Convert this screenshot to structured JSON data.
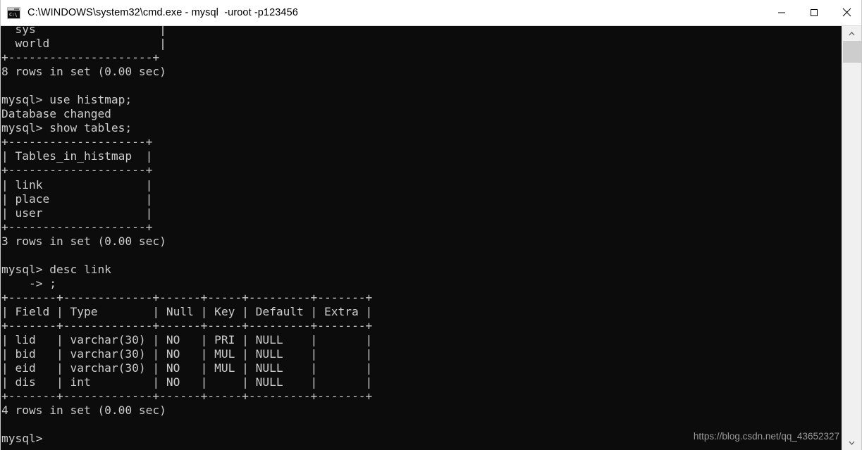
{
  "window": {
    "title": "C:\\WINDOWS\\system32\\cmd.exe - mysql  -uroot -p123456",
    "icon_name": "cmd-exe-icon",
    "icon_prompt_glyph": "C:\\",
    "background_color": "#0c0c0c",
    "titlebar_background": "#ffffff",
    "text_color": "#cccccc"
  },
  "controls": {
    "minimize_label": "Minimize",
    "maximize_label": "Maximize",
    "close_label": "Close"
  },
  "console": {
    "prompt": "mysql>",
    "continuation_prompt": "    -> ",
    "text": "  sys                  |\n  world                |\n+---------------------+\n8 rows in set (0.00 sec)\n\nmysql> use histmap;\nDatabase changed\nmysql> show tables;\n+--------------------+\n| Tables_in_histmap  |\n+--------------------+\n| link               |\n| place              |\n| user               |\n+--------------------+\n3 rows in set (0.00 sec)\n\nmysql> desc link\n    -> ;\n+-------+-------------+------+-----+---------+-------+\n| Field | Type        | Null | Key | Default | Extra |\n+-------+-------------+------+-----+---------+-------+\n| lid   | varchar(30) | NO   | PRI | NULL    |       |\n| bid   | varchar(30) | NO   | MUL | NULL    |       |\n| eid   | varchar(30) | NO   | MUL | NULL    |       |\n| dis   | int         | NO   |     | NULL    |       |\n+-------+-------------+------+-----+---------+-------+\n4 rows in set (0.00 sec)\n\nmysql>",
    "commands": [
      "use histmap;",
      "show tables;",
      "desc link"
    ],
    "results": [
      {
        "name": "show-databases-result-tail",
        "rows": [
          "sys",
          "world"
        ],
        "status": "8 rows in set (0.00 sec)"
      },
      {
        "name": "show-tables-result",
        "headers": [
          "Tables_in_histmap"
        ],
        "rows": [
          [
            "link"
          ],
          [
            "place"
          ],
          [
            "user"
          ]
        ],
        "status": "3 rows in set (0.00 sec)"
      },
      {
        "name": "desc-link-result",
        "headers": [
          "Field",
          "Type",
          "Null",
          "Key",
          "Default",
          "Extra"
        ],
        "rows": [
          [
            "lid",
            "varchar(30)",
            "NO",
            "PRI",
            "NULL",
            ""
          ],
          [
            "bid",
            "varchar(30)",
            "NO",
            "MUL",
            "NULL",
            ""
          ],
          [
            "eid",
            "varchar(30)",
            "NO",
            "MUL",
            "NULL",
            ""
          ],
          [
            "dis",
            "int",
            "NO",
            "",
            "NULL",
            ""
          ]
        ],
        "status": "4 rows in set (0.00 sec)"
      }
    ],
    "messages": [
      "Database changed"
    ]
  },
  "watermark": {
    "text": "https://blog.csdn.net/qq_43652327"
  },
  "scrollbar": {
    "up_arrow": "scroll-up",
    "down_arrow": "scroll-down",
    "thumb_color": "#cdcdcd",
    "track_color": "#f0f0f0"
  }
}
